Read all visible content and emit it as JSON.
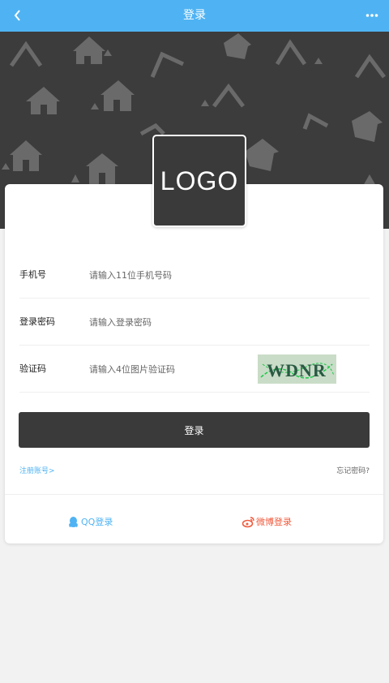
{
  "header": {
    "title": "登录",
    "back_icon": "chevron-left-icon",
    "more_icon": "more-dots-icon",
    "color": "#4fb3f3"
  },
  "logo": {
    "text": "LOGO"
  },
  "form": {
    "phone": {
      "label": "手机号",
      "placeholder": "请输入11位手机号码"
    },
    "password": {
      "label": "登录密码",
      "placeholder": "请输入登录密码"
    },
    "captcha": {
      "label": "验证码",
      "placeholder": "请输入4位图片验证码",
      "image_text": "WDNR"
    }
  },
  "login_button": "登录",
  "links": {
    "register": "注册账号>",
    "forgot": "忘记密码?"
  },
  "social": {
    "qq": "QQ登录",
    "weibo": "微博登录"
  }
}
